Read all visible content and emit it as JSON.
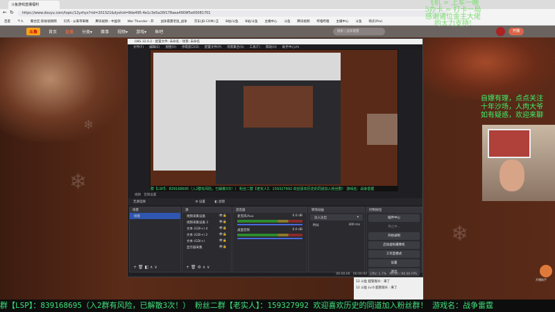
{
  "browser": {
    "tab_title": "斗鱼游戏直播福利",
    "url": "https://www.douyu.com/topic/12yzhyx?rid=201321&dyshid=8de495-4e1c3e5a26f178aea4909f5e00081701",
    "bookmarks": [
      "百度",
      "个人",
      "聚合区-影视视频网",
      "贝壳 - 从来带来精",
      "腾讯视频 - 中国领",
      "War Thunder - 开",
      "战争雷霆老鼠_战争",
      "京东(JD.COM)-正",
      "B站/斗鱼",
      "B站/斗鱼",
      "主播中心",
      "斗鱼",
      "腾讯视频",
      "哔哩哔哩",
      "主播中心",
      "斗鱼",
      "购买(Pro)"
    ]
  },
  "nav": {
    "logo": "斗鱼",
    "items": [
      "首页",
      "直播",
      "分类▾",
      "赛事",
      "视频▾",
      "游戏▾",
      "鱼吧"
    ],
    "active": "直播",
    "search_placeholder": "搜索 | 战争雷霆",
    "live_button": "开播"
  },
  "overlay_top": [
    "飞机 = 上车一晚",
    "5办卡 = 打卡一局",
    "感谢诸位金主大佬",
    "的大力支持!"
  ],
  "overlay_right": [
    "自嫖有理，点点关注",
    "十年沙场，人肉大爷",
    "如有疑惑，欢迎来聊"
  ],
  "obs": {
    "title": "OBS 32.0.2 - 配置文件: 未命名 - 场景: 未命名",
    "menu": [
      "文件(F)",
      "编辑(E)",
      "视图(V)",
      "停靠窗口(D)",
      "配置文件(P)",
      "场景集合(S)",
      "工具(T)",
      "帮助(H)",
      "助手中心(A)"
    ],
    "sub_labels": [
      "视频",
      "音频设置"
    ],
    "toolbar": {
      "label": "无源选择",
      "settings": "设置",
      "filters": "滤镜"
    },
    "scenes": {
      "title": "场景",
      "items": [
        "场景"
      ]
    },
    "sources": {
      "title": "源",
      "items": [
        "视频采集设备",
        "视频采集设备 2",
        "文本 (GDI+) 4",
        "文本 (GDI+) 2",
        "文本 (GDI+)",
        "显示器采集"
      ]
    },
    "mixer": {
      "title": "混音器",
      "channels": [
        {
          "name": "麦克风/Aux",
          "db": "0.0 dB"
        },
        {
          "name": "桌面音频",
          "db": "0.0 dB"
        }
      ]
    },
    "transitions": {
      "title": "转场动画",
      "type": "淡入淡出",
      "duration_label": "时长",
      "duration": "300 ms"
    },
    "controls": {
      "title": "控制按钮",
      "buttons": [
        "插件中心",
        "停止中...",
        "开始录制",
        "启动虚拟摄像机",
        "工作室模式",
        "设置",
        "退出"
      ]
    },
    "status": {
      "time1": "00:00:00",
      "time2": "00:00:00",
      "cpu": "CPU: 1.7%",
      "fps": "90.00 / 90.00 FPS"
    }
  },
  "chat": [
    "12 斗鱼 超管观众 : 来了",
    "12 斗鱼 Lv.0 超管观众 : 来了"
  ],
  "assistant": "开播助手",
  "ticker": "群【LSP】：839168695（入2群有风险，已解散3次！） 粉丝二群【老实人】：159327992 欢迎喜欢历史的同道加入粉丝群！ 游戏名：战争雷霆"
}
